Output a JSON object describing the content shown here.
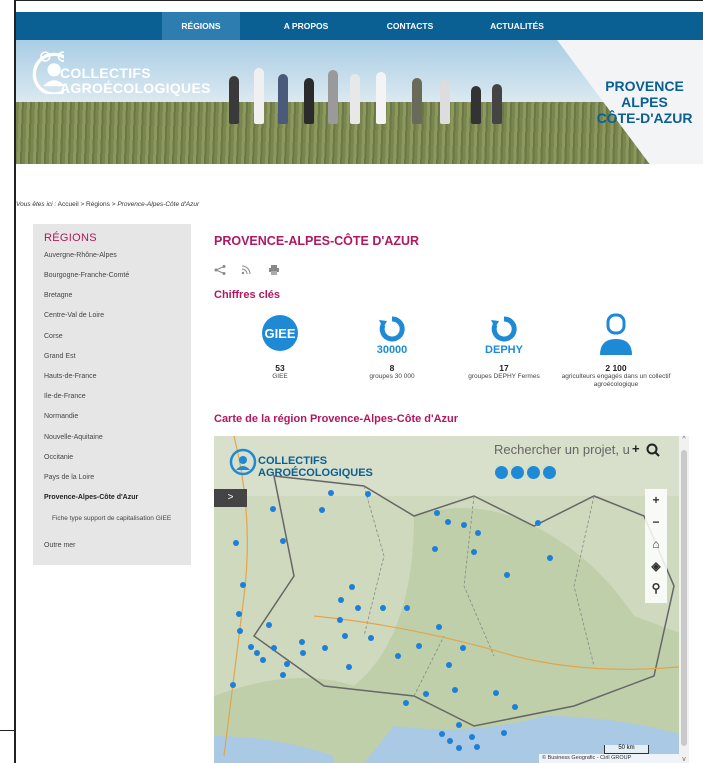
{
  "nav": {
    "items": [
      "RÉGIONS",
      "A PROPOS",
      "CONTACTS",
      "ACTUALITÉS"
    ],
    "active": 0
  },
  "brand": {
    "line1": "COLLECTIFS",
    "line2": "AGROÉCOLOGIQUES"
  },
  "hero": {
    "region_line1": "PROVENCE",
    "region_line2": "ALPES",
    "region_line3": "CÔTE-D'AZUR"
  },
  "breadcrumb": {
    "prefix": "Vous êtes ici :",
    "path": " Accueil > Régions > ",
    "current": "Provence-Alpes-Côte d'Azur"
  },
  "sidebar": {
    "title": "RÉGIONS",
    "items": [
      "Auvergne-Rhône-Alpes",
      "Bourgogne-Franche-Comté",
      "Bretagne",
      "Centre-Val de Loire",
      "Corse",
      "Grand Est",
      "Hauts-de-France",
      "Ile-de-France",
      "Normandie",
      "Nouvelle-Aquitaine",
      "Occitanie",
      "Pays de la Loire",
      "Provence-Alpes-Côte d'Azur"
    ],
    "sub_item": "Fiche type support de capitalisation GIEE",
    "last": "Outre mer"
  },
  "main": {
    "title": "PROVENCE-ALPES-CÔTE D'AZUR",
    "kpi_heading": "Chiffres clés",
    "kpis": [
      {
        "icon": "giee-icon",
        "icon_text": "GIEE",
        "num": "53",
        "label": "GIEE"
      },
      {
        "icon": "30000-icon",
        "icon_text": "30000",
        "num": "8",
        "label": "groupes 30 000"
      },
      {
        "icon": "dephy-icon",
        "icon_text": "DEPHY",
        "num": "17",
        "label": "groupes DEPHY Fermes"
      },
      {
        "icon": "farmer-icon",
        "icon_text": "",
        "num": "2 100",
        "label": "agriculteurs engagés dans un collectif agroécologique"
      }
    ],
    "map_heading": "Carte de la région Provence-Alpes-Côte d'Azur"
  },
  "map": {
    "search_placeholder": "Rechercher un projet, u",
    "logo_line1": "COLLECTIFS",
    "logo_line2": "AGROÉCOLOGIQUES",
    "scale": "50 km",
    "attribution": "© Business Geografic - Ciril GROUP",
    "accent": "#1e7fd8"
  },
  "colors": {
    "nav": "#0a5f93",
    "accent": "#b0185f"
  }
}
